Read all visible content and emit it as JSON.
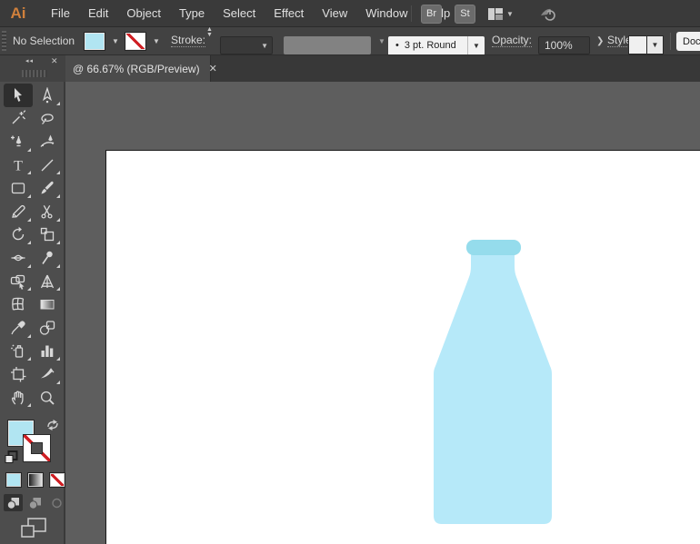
{
  "menubar": {
    "logo": "Ai",
    "items": [
      "File",
      "Edit",
      "Object",
      "Type",
      "Select",
      "Effect",
      "View",
      "Window",
      "Help"
    ],
    "bridge_button": "Br",
    "stock_button": "St"
  },
  "controlbar": {
    "selection_status": "No Selection",
    "stroke_label": "Stroke:",
    "brush_bullet": "•",
    "brush_name": "3 pt. Round",
    "opacity_label": "Opacity:",
    "opacity_value": "100%",
    "style_label": "Style:",
    "document_setup_label": "Docu"
  },
  "tabbar": {
    "dock_collapse": "◂◂",
    "dock_close": "✕",
    "document_tab": "@ 66.67% (RGB/Preview)",
    "tab_close": "✕"
  },
  "toolbar": {
    "tools": [
      {
        "name": "selection",
        "icon": "selection-icon",
        "active": true,
        "flyout": false
      },
      {
        "name": "direct-selection",
        "icon": "direct-selection-icon",
        "active": false,
        "flyout": true
      },
      {
        "name": "magic-wand",
        "icon": "magic-wand-icon",
        "active": false,
        "flyout": false
      },
      {
        "name": "lasso",
        "icon": "lasso-icon",
        "active": false,
        "flyout": false
      },
      {
        "name": "pen",
        "icon": "pen-icon",
        "active": false,
        "flyout": true
      },
      {
        "name": "curvature",
        "icon": "curvature-icon",
        "active": false,
        "flyout": false
      },
      {
        "name": "type",
        "icon": "type-icon",
        "active": false,
        "flyout": true
      },
      {
        "name": "line-segment",
        "icon": "line-icon",
        "active": false,
        "flyout": true
      },
      {
        "name": "rectangle",
        "icon": "rectangle-icon",
        "active": false,
        "flyout": true
      },
      {
        "name": "paintbrush",
        "icon": "paintbrush-icon",
        "active": false,
        "flyout": true
      },
      {
        "name": "pencil",
        "icon": "pencil-icon",
        "active": false,
        "flyout": true
      },
      {
        "name": "scissors",
        "icon": "scissors-icon",
        "active": false,
        "flyout": true
      },
      {
        "name": "rotate",
        "icon": "rotate-icon",
        "active": false,
        "flyout": true
      },
      {
        "name": "scale",
        "icon": "scale-icon",
        "active": false,
        "flyout": true
      },
      {
        "name": "width",
        "icon": "width-icon",
        "active": false,
        "flyout": true
      },
      {
        "name": "puppet-warp",
        "icon": "puppet-warp-icon",
        "active": false,
        "flyout": true
      },
      {
        "name": "shape-builder",
        "icon": "shape-builder-icon",
        "active": false,
        "flyout": true
      },
      {
        "name": "perspective-grid",
        "icon": "perspective-grid-icon",
        "active": false,
        "flyout": true
      },
      {
        "name": "mesh",
        "icon": "mesh-icon",
        "active": false,
        "flyout": false
      },
      {
        "name": "gradient",
        "icon": "gradient-icon",
        "active": false,
        "flyout": false
      },
      {
        "name": "eyedropper",
        "icon": "eyedropper-icon",
        "active": false,
        "flyout": true
      },
      {
        "name": "blend",
        "icon": "blend-icon",
        "active": false,
        "flyout": false
      },
      {
        "name": "symbol-sprayer",
        "icon": "symbol-sprayer-icon",
        "active": false,
        "flyout": true
      },
      {
        "name": "column-graph",
        "icon": "column-graph-icon",
        "active": false,
        "flyout": true
      },
      {
        "name": "artboard",
        "icon": "artboard-icon",
        "active": false,
        "flyout": false
      },
      {
        "name": "slice",
        "icon": "slice-icon",
        "active": false,
        "flyout": true
      },
      {
        "name": "hand",
        "icon": "hand-icon",
        "active": false,
        "flyout": true
      },
      {
        "name": "zoom",
        "icon": "zoom-icon",
        "active": false,
        "flyout": false
      }
    ]
  },
  "colors": {
    "fill_swatch": "#b1e5f2",
    "stroke_none_red": "#cf1f24",
    "bottle_body": "#b6e9f9",
    "bottle_cap": "#95dcec",
    "logo_orange": "#d0803c"
  },
  "artwork": {
    "object": "milk-bottle-shape",
    "body_color": "#b6e9f9",
    "cap_color": "#95dcec"
  }
}
